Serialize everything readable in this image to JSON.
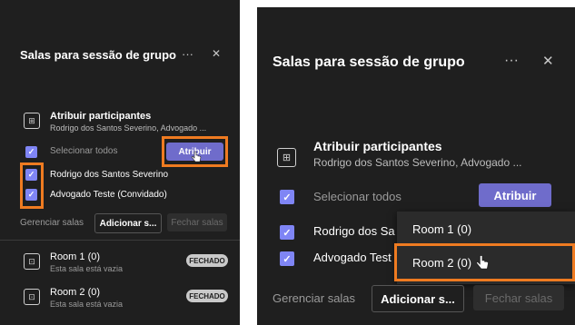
{
  "left": {
    "title": "Salas para sessão de grupo",
    "more": "···",
    "close": "✕",
    "assign_title": "Atribuir participantes",
    "assign_sub": "Rodrigo dos Santos Severino, Advogado ...",
    "select_all": "Selecionar todos",
    "assign_button": "Atribuir",
    "participants": [
      "Rodrigo dos Santos Severino",
      "Advogado Teste (Convidado)"
    ],
    "manage_rooms": "Gerenciar salas",
    "add_rooms_button": "Adicionar s...",
    "close_rooms_button": "Fechar salas",
    "rooms": [
      {
        "name": "Room 1 (0)",
        "status": "Esta sala está vazia",
        "badge": "FECHADO"
      },
      {
        "name": "Room 2 (0)",
        "status": "Esta sala está vazia",
        "badge": "FECHADO"
      }
    ]
  },
  "right": {
    "title": "Salas para sessão de grupo",
    "more": "···",
    "close": "✕",
    "assign_title": "Atribuir participantes",
    "assign_sub": "Rodrigo dos Santos Severino, Advogado ...",
    "select_all": "Selecionar todos",
    "assign_button": "Atribuir",
    "participants": [
      "Rodrigo dos Sa",
      "Advogado Test"
    ],
    "dropdown": [
      "Room 1 (0)",
      "Room 2 (0)"
    ],
    "manage_rooms": "Gerenciar salas",
    "add_rooms_button": "Adicionar s...",
    "close_rooms_button": "Fechar salas"
  },
  "colors": {
    "panel_bg": "#1f1f1f",
    "accent": "#6f6ccb",
    "checkbox": "#7f85f5",
    "highlight": "#ef7b21"
  }
}
